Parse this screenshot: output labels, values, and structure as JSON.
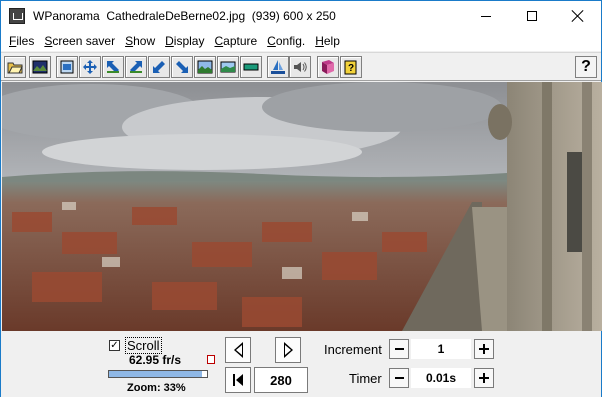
{
  "window": {
    "title": "WPanorama  CathedraleDeBerne02.jpg  (939) 600 x 250"
  },
  "menu": [
    {
      "label": "Files",
      "u": "F",
      "rest": "iles"
    },
    {
      "label": "Screen saver",
      "u": "S",
      "rest": "creen saver"
    },
    {
      "label": "Show",
      "u": "S",
      "rest": "how"
    },
    {
      "label": "Display",
      "u": "D",
      "rest": "isplay"
    },
    {
      "label": "Capture",
      "u": "C",
      "rest": "apture"
    },
    {
      "label": "Config.",
      "u": "C",
      "rest": "onfig."
    },
    {
      "label": "Help",
      "u": "H",
      "rest": "elp"
    }
  ],
  "toolbar": {
    "buttons": [
      {
        "name": "open-folder-icon"
      },
      {
        "name": "picture-icon"
      },
      {
        "name": "fit-window-icon"
      },
      {
        "name": "move-icon"
      },
      {
        "name": "arrow-up-left-icon"
      },
      {
        "name": "arrow-up-right-icon"
      },
      {
        "name": "arrow-down-left-icon"
      },
      {
        "name": "arrow-down-right-icon"
      },
      {
        "name": "landscape-icon"
      },
      {
        "name": "landscape-wide-icon"
      },
      {
        "name": "landscape-flat-icon"
      },
      {
        "name": "sailboat-icon"
      },
      {
        "name": "speaker-icon"
      },
      {
        "name": "book-icon"
      },
      {
        "name": "help-book-icon"
      }
    ],
    "help_label": "?"
  },
  "controls": {
    "scroll_label": "Scroll",
    "scroll_checked": "✓",
    "fps": "62.95 fr/s",
    "zoom_label": "Zoom: 33%",
    "zoom_fraction": 0.95,
    "position": "280",
    "increment_label": "Increment",
    "increment_value": "1",
    "timer_label": "Timer",
    "timer_value": "0.01s"
  },
  "colors": {
    "sky": "#b9bcbf",
    "roofs": "#8a4a36",
    "stone": "#a79d8c"
  }
}
